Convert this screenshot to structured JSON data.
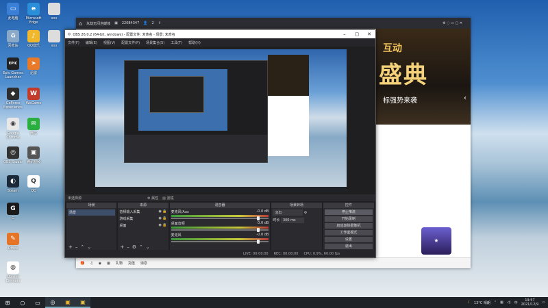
{
  "desktop": {
    "icons": [
      {
        "label": "此电脑",
        "color": "#3b7fd6",
        "glyph": "▭"
      },
      {
        "label": "Microsoft Edge",
        "color": "#2a8fd8",
        "glyph": "e"
      },
      {
        "label": "回收站",
        "color": "#8aa9c8",
        "glyph": "♻"
      },
      {
        "label": "QQ音乐",
        "color": "#f1b82d",
        "glyph": "♪"
      },
      {
        "label": "Epic Games Launcher",
        "color": "#222",
        "glyph": "EPIC"
      },
      {
        "label": "迅雷",
        "color": "#e87a2a",
        "glyph": "➤"
      },
      {
        "label": "GeForce Experience",
        "color": "#2d2d2d",
        "glyph": "◆"
      },
      {
        "label": "WeGame",
        "color": "#c23b2b",
        "glyph": "W"
      },
      {
        "label": "Google Chrome",
        "color": "#e8e8e8",
        "glyph": "◉"
      },
      {
        "label": "微信",
        "color": "#2aae3f",
        "glyph": "✉"
      },
      {
        "label": "OBS Studio",
        "color": "#333",
        "glyph": "◎"
      },
      {
        "label": "腾讯视频",
        "color": "#555",
        "glyph": "▣"
      },
      {
        "label": "Steam",
        "color": "#1b2838",
        "glyph": "◐"
      },
      {
        "label": "QQ",
        "color": "#fff",
        "glyph": "Q"
      },
      {
        "label": "G",
        "color": "#1a1a1a",
        "glyph": "G"
      },
      {
        "label": "Office",
        "color": "#e57427",
        "glyph": "✎"
      },
      {
        "label": "Ubisoft Connect",
        "color": "#fff",
        "glyph": "◍"
      }
    ],
    "partial_icons": [
      "xxx",
      "xxx"
    ]
  },
  "taskbar": {
    "weather": "13°C 晴朗",
    "time": "19:57",
    "date": "2021/12/9"
  },
  "live_app": {
    "title": "永劫无间自媒体",
    "room_id": "22084347",
    "viewers": "2",
    "banner_line1": "互动",
    "banner_line2": "盛典",
    "banner_line3": "标强势来袭",
    "bottom_items": [
      "礼物",
      "充值",
      "消息"
    ]
  },
  "obs": {
    "title": "OBS 26.0.2 (64-bit, windows) - 配置文件: 未命名 - 场景: 未命名",
    "menu": [
      "文件(F)",
      "编辑(E)",
      "视图(V)",
      "配置文件(P)",
      "场景集合(S)",
      "工具(T)",
      "帮助(H)"
    ],
    "source_bar": [
      "未选择源",
      "属性",
      "滤镜"
    ],
    "docks": {
      "scenes": {
        "title": "场景",
        "items": [
          "场景"
        ]
      },
      "sources": {
        "title": "来源",
        "items": [
          "音频输入采集",
          "游戏采集",
          "桌面"
        ]
      },
      "mixer": {
        "title": "混音器",
        "channels": [
          {
            "name": "麦克风/Aux",
            "db": "-0.0 dB"
          },
          {
            "name": "桌面音频",
            "db": "0.0 dB"
          },
          {
            "name": "麦克风",
            "db": "-0.0 dB"
          }
        ]
      },
      "transitions": {
        "title": "场景转场",
        "type": "淡出",
        "duration_label": "时长",
        "duration": "300 ms"
      },
      "controls": {
        "title": "控件",
        "buttons": [
          "停止推流",
          "开始录制",
          "启动虚拟摄像机",
          "工作室模式",
          "设置",
          "退出"
        ]
      }
    },
    "status": {
      "live": "LIVE: 00:00:00",
      "rec": "REC: 00:00:00",
      "cpu": "CPU: 0.9%, 60.00 fps"
    }
  }
}
